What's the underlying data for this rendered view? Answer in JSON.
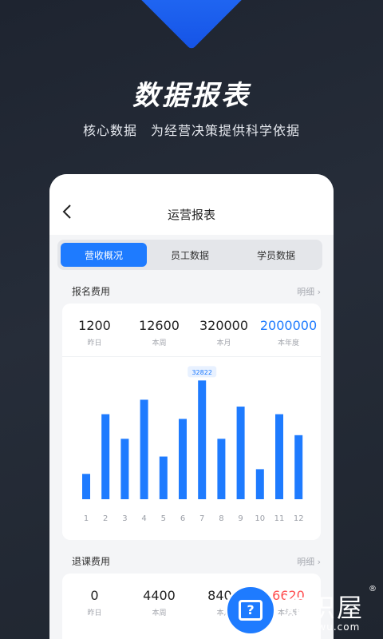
{
  "hero": {
    "title": "数据报表",
    "subtitle": "核心数据　为经营决策提供科学依据"
  },
  "nav": {
    "back_icon": "chevron-left-icon",
    "title": "运营报表"
  },
  "tabs": [
    {
      "label": "营收概况",
      "active": true
    },
    {
      "label": "员工数据",
      "active": false
    },
    {
      "label": "学员数据",
      "active": false
    }
  ],
  "registration": {
    "label": "报名费用",
    "detail": "明细 ›",
    "stats": [
      {
        "value": "1200",
        "label": "昨日"
      },
      {
        "value": "12600",
        "label": "本周"
      },
      {
        "value": "320000",
        "label": "本月"
      },
      {
        "value": "2000000",
        "label": "本年度"
      }
    ]
  },
  "chart_data": {
    "type": "bar",
    "categories": [
      "1",
      "2",
      "3",
      "4",
      "5",
      "6",
      "7",
      "8",
      "9",
      "10",
      "11",
      "12"
    ],
    "values": [
      7000,
      23500,
      16700,
      27500,
      11800,
      22200,
      32822,
      16700,
      25600,
      8300,
      23500,
      17700
    ],
    "highlight": {
      "index": 6,
      "label": "32822"
    },
    "ylim": [
      0,
      34000
    ],
    "grid": false,
    "bar_color": "#1e7bff"
  },
  "refund": {
    "label": "退课费用",
    "detail": "明细 ›",
    "stats": [
      {
        "value": "0",
        "label": "昨日"
      },
      {
        "value": "4400",
        "label": "本周"
      },
      {
        "value": "8400",
        "label": "本月"
      },
      {
        "value": "6620",
        "label": "本年度"
      }
    ]
  },
  "watermark": {
    "brand": "知识屋",
    "domain": "zhishiwu.com",
    "reg": "®",
    "icon": "monitor-question-icon",
    "glyph": "?"
  },
  "colors": {
    "accent": "#1e7bff",
    "negative": "#ff4d4f",
    "background": "#232a35"
  }
}
